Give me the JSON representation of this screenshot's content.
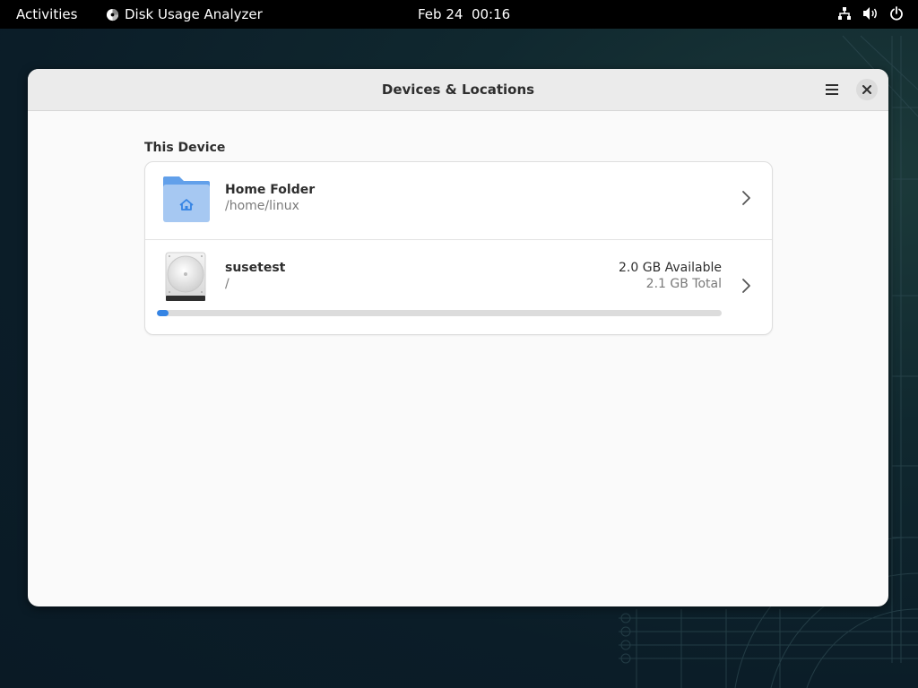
{
  "topbar": {
    "activities": "Activities",
    "app_name": "Disk Usage Analyzer",
    "clock": "Feb 24  00:16",
    "tray_icons": [
      "network-icon",
      "volume-icon",
      "power-icon"
    ]
  },
  "window": {
    "title": "Devices & Locations",
    "menu_icon": "hamburger-menu-icon",
    "close_icon": "close-icon"
  },
  "section": {
    "label": "This Device"
  },
  "locations": {
    "home": {
      "name": "Home Folder",
      "path": "/home/linux",
      "icon": "home-folder-icon"
    },
    "disk": {
      "name": "susetest",
      "path": "/",
      "available": "2.0 GB Available",
      "total": "2.1 GB Total",
      "used_fraction": 0.02,
      "icon": "hard-disk-icon"
    }
  },
  "colors": {
    "accent": "#3584e4",
    "folder": "#a6c8f2",
    "folder_tab": "#62a0ea"
  }
}
